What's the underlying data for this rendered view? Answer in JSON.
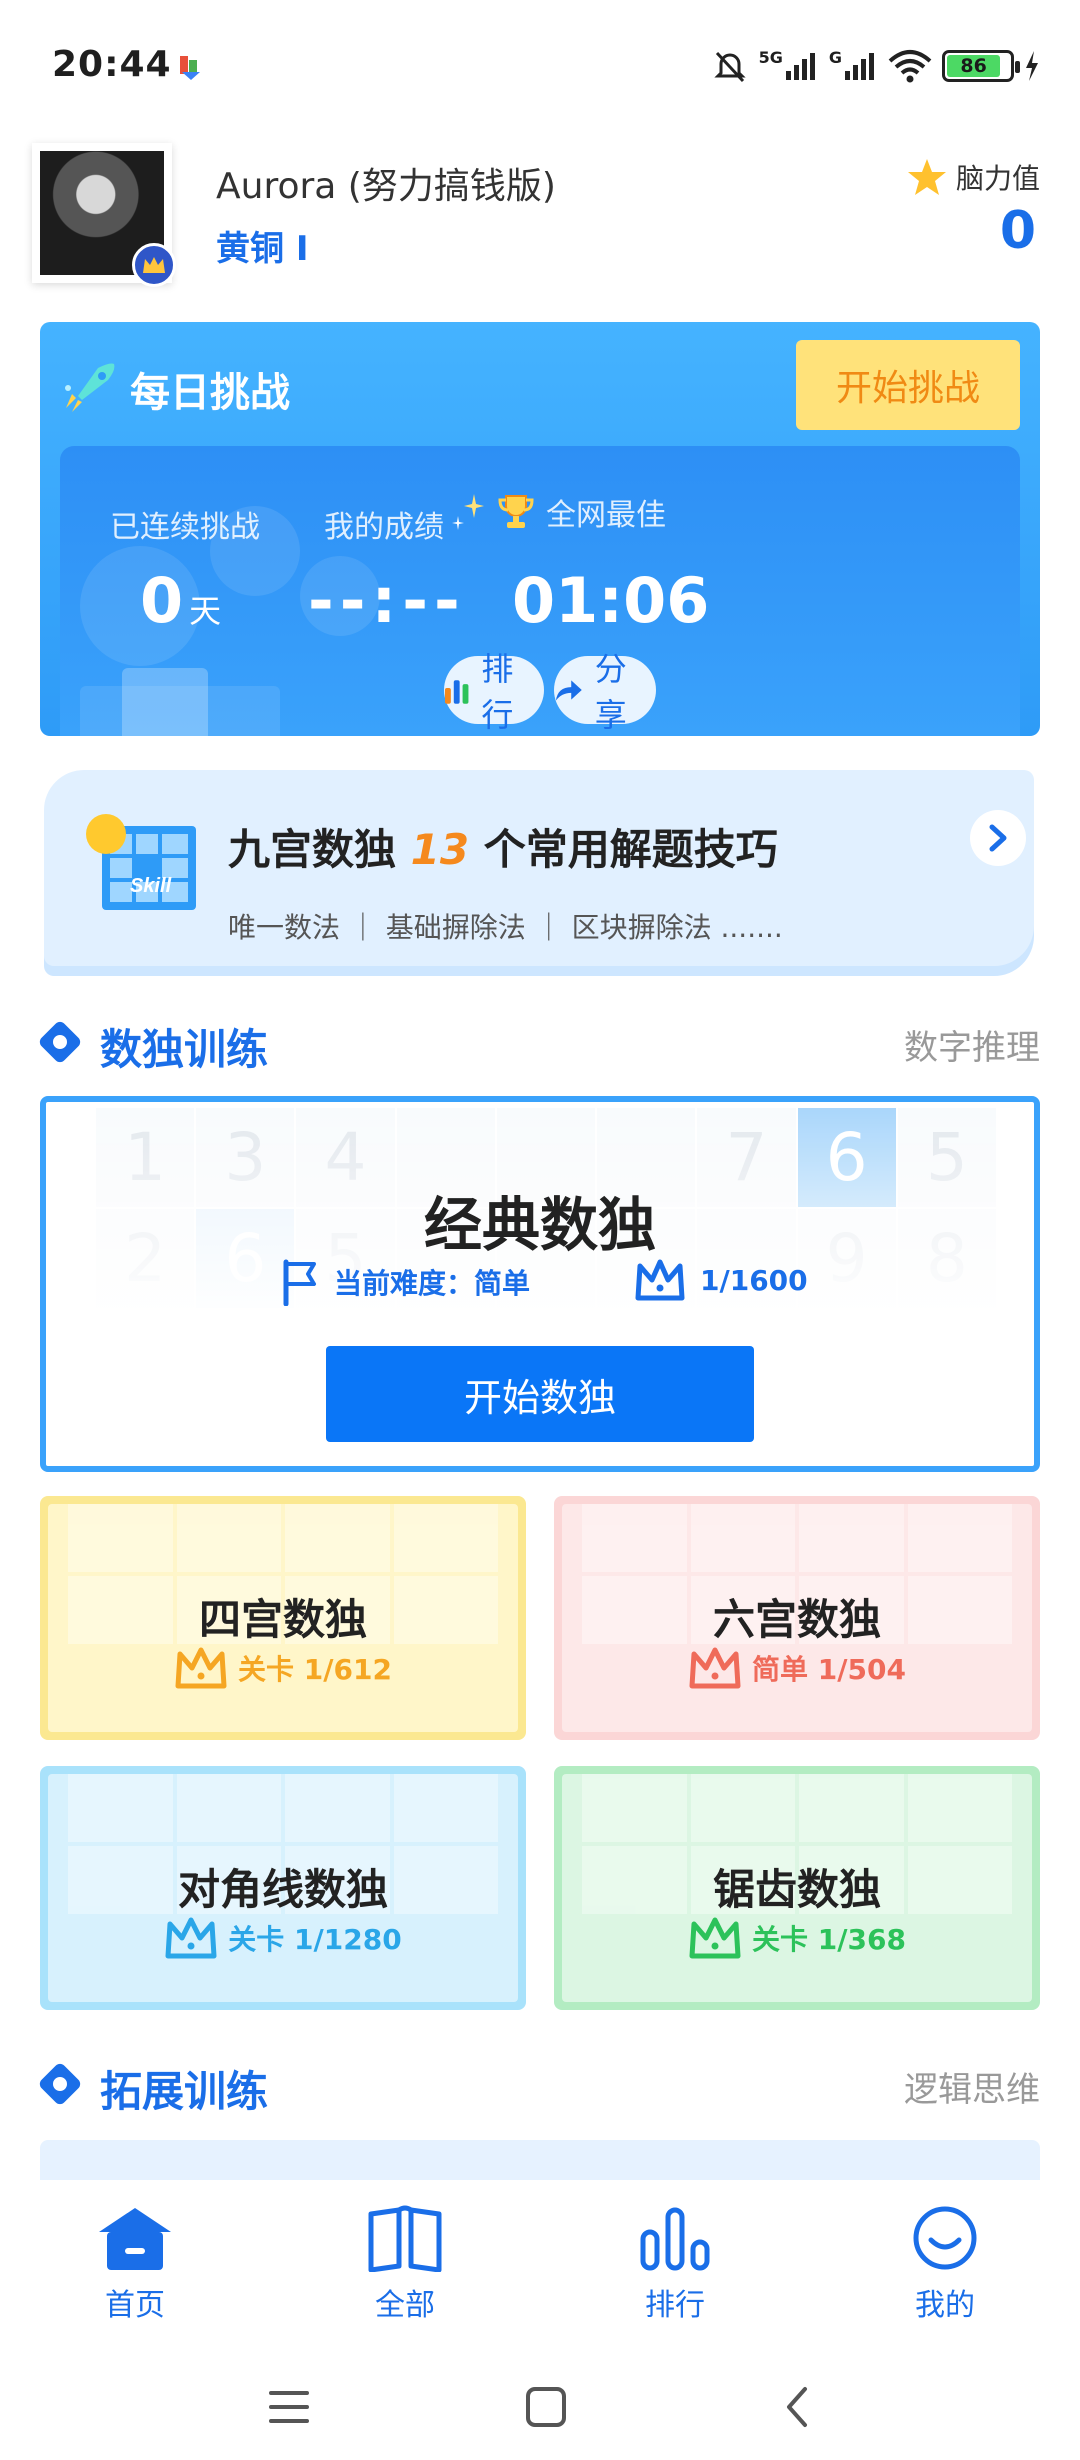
{
  "status_bar": {
    "time": "20:44",
    "battery": "86",
    "network": "5G",
    "network2": "G"
  },
  "profile": {
    "username": "Aurora (努力搞钱版)",
    "rank": "黄铜 I",
    "brain_label": "脑力值",
    "brain_value": "0"
  },
  "daily": {
    "title": "每日挑战",
    "start_button": "开始挑战",
    "streak_label": "已连续挑战",
    "streak_value": "0",
    "streak_unit": "天",
    "my_score_label": "我的成绩",
    "my_score_value": "--:--",
    "best_label": "全网最佳",
    "best_value": "01:06",
    "rank_button": "排行",
    "share_button": "分享"
  },
  "tips": {
    "title_prefix": "九宫数独",
    "title_num": "13",
    "title_suffix": "个常用解题技巧",
    "subtitle": "唯一数法 ｜ 基础摒除法 ｜ 区块摒除法 .......",
    "icon_text": "Skill"
  },
  "section_sudoku": {
    "title": "数独训练",
    "more": "数字推理"
  },
  "classic": {
    "title": "经典数独",
    "difficulty": "当前难度：简单",
    "progress": "1/1600",
    "button": "开始数独",
    "grid_row1": [
      "1",
      "3",
      "4",
      "",
      "",
      "",
      "7",
      "6",
      "5"
    ],
    "grid_row2": [
      "2",
      "6",
      "5",
      "",
      "",
      "",
      "",
      "9",
      "8"
    ]
  },
  "modes": [
    {
      "name": "四宫数独",
      "meta": "关卡 1/612",
      "color": "#f5a623",
      "bg": "#fff6c9",
      "border": "#fbe891"
    },
    {
      "name": "六宫数独",
      "meta": "简单 1/504",
      "color": "#ef6b5a",
      "bg": "#fde8e8",
      "border": "#fbd6d6"
    },
    {
      "name": "对角线数独",
      "meta": "关卡 1/1280",
      "color": "#2aa6e8",
      "bg": "#d7f1fd",
      "border": "#a9e2fb"
    },
    {
      "name": "锯齿数独",
      "meta": "关卡 1/368",
      "color": "#2cc25a",
      "bg": "#dcf6e3",
      "border": "#b3ecc2"
    }
  ],
  "section_extend": {
    "title": "拓展训练",
    "more": "逻辑思维"
  },
  "tabs": [
    {
      "label": "首页",
      "icon": "home-icon"
    },
    {
      "label": "全部",
      "icon": "book-icon"
    },
    {
      "label": "排行",
      "icon": "bar-chart-icon"
    },
    {
      "label": "我的",
      "icon": "smile-icon"
    }
  ],
  "colors": {
    "accent": "#1a6ee8",
    "daily_bg": "#3aa2fb",
    "start_btn": "#ffe27a"
  }
}
